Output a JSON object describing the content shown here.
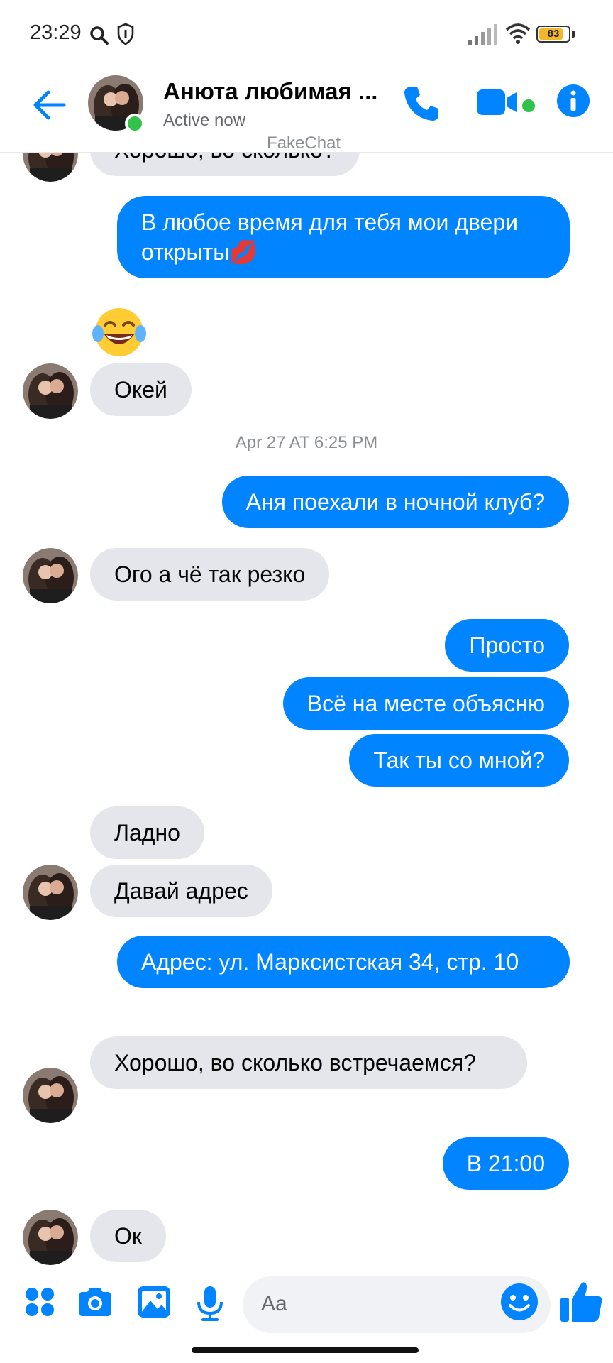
{
  "status_bar": {
    "time": "23:29",
    "battery": "83",
    "battery_level": 0.83
  },
  "header": {
    "contact_name": "Анюта любимая ...",
    "status": "Active now",
    "watermark": "FakeChat"
  },
  "messages": [
    {
      "sender": "them",
      "text": "Хорошо, во сколько?"
    },
    {
      "sender": "me",
      "text": "В любое время для тебя мои двери открыты💋"
    },
    {
      "sender": "them",
      "type": "emoji",
      "icon": "tears-of-joy-emoji"
    },
    {
      "sender": "them",
      "text": "Окей"
    },
    {
      "type": "timestamp",
      "text": "Apr 27 AT 6:25 PM"
    },
    {
      "sender": "me",
      "text": "Аня поехали в ночной клуб?"
    },
    {
      "sender": "them",
      "text": "Ого а чё так резко"
    },
    {
      "sender": "me",
      "text": "Просто"
    },
    {
      "sender": "me",
      "text": "Всё на месте объясню"
    },
    {
      "sender": "me",
      "text": "Так ты со мной?"
    },
    {
      "sender": "them",
      "text": "Ладно"
    },
    {
      "sender": "them",
      "text": "Давай адрес"
    },
    {
      "sender": "me",
      "text": "Адрес: ул. Марксистская 34, стр. 10"
    },
    {
      "sender": "them",
      "text": "Хорошо, во сколько встречаемся?"
    },
    {
      "sender": "me",
      "text": "В 21:00"
    },
    {
      "sender": "them",
      "text": "Ок"
    }
  ],
  "composer": {
    "placeholder": "Aa",
    "icons": [
      "apps-icon",
      "camera-icon",
      "gallery-icon",
      "microphone-icon",
      "emoji-icon",
      "thumbs-up-icon"
    ]
  },
  "colors": {
    "accent": "#0084ff",
    "incoming_bubble": "#e4e6eb",
    "online": "#31c24a"
  }
}
